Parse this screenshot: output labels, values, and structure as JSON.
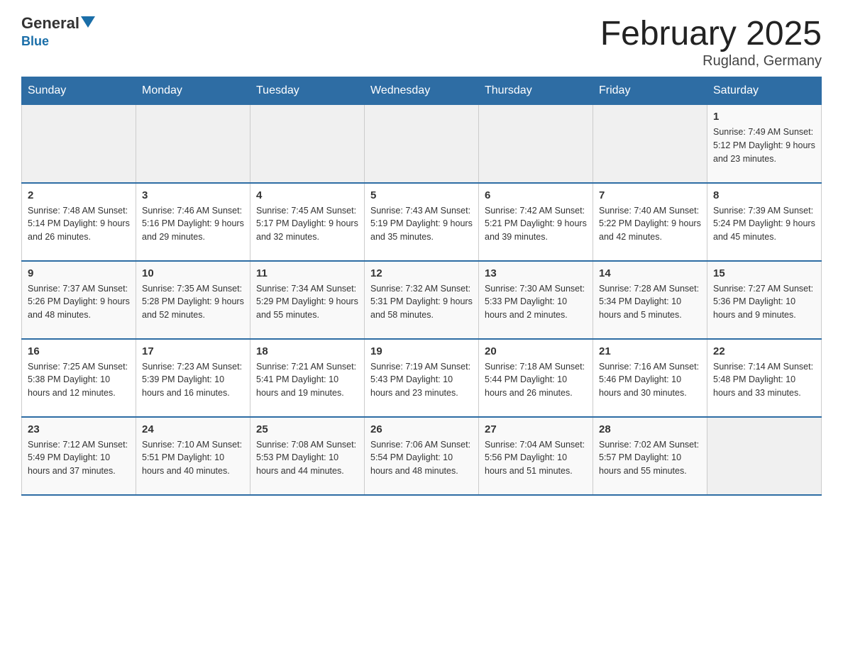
{
  "header": {
    "logo_general": "General",
    "logo_blue": "Blue",
    "month_title": "February 2025",
    "location": "Rugland, Germany"
  },
  "weekdays": [
    "Sunday",
    "Monday",
    "Tuesday",
    "Wednesday",
    "Thursday",
    "Friday",
    "Saturday"
  ],
  "weeks": [
    [
      {
        "day": "",
        "info": ""
      },
      {
        "day": "",
        "info": ""
      },
      {
        "day": "",
        "info": ""
      },
      {
        "day": "",
        "info": ""
      },
      {
        "day": "",
        "info": ""
      },
      {
        "day": "",
        "info": ""
      },
      {
        "day": "1",
        "info": "Sunrise: 7:49 AM\nSunset: 5:12 PM\nDaylight: 9 hours and 23 minutes."
      }
    ],
    [
      {
        "day": "2",
        "info": "Sunrise: 7:48 AM\nSunset: 5:14 PM\nDaylight: 9 hours and 26 minutes."
      },
      {
        "day": "3",
        "info": "Sunrise: 7:46 AM\nSunset: 5:16 PM\nDaylight: 9 hours and 29 minutes."
      },
      {
        "day": "4",
        "info": "Sunrise: 7:45 AM\nSunset: 5:17 PM\nDaylight: 9 hours and 32 minutes."
      },
      {
        "day": "5",
        "info": "Sunrise: 7:43 AM\nSunset: 5:19 PM\nDaylight: 9 hours and 35 minutes."
      },
      {
        "day": "6",
        "info": "Sunrise: 7:42 AM\nSunset: 5:21 PM\nDaylight: 9 hours and 39 minutes."
      },
      {
        "day": "7",
        "info": "Sunrise: 7:40 AM\nSunset: 5:22 PM\nDaylight: 9 hours and 42 minutes."
      },
      {
        "day": "8",
        "info": "Sunrise: 7:39 AM\nSunset: 5:24 PM\nDaylight: 9 hours and 45 minutes."
      }
    ],
    [
      {
        "day": "9",
        "info": "Sunrise: 7:37 AM\nSunset: 5:26 PM\nDaylight: 9 hours and 48 minutes."
      },
      {
        "day": "10",
        "info": "Sunrise: 7:35 AM\nSunset: 5:28 PM\nDaylight: 9 hours and 52 minutes."
      },
      {
        "day": "11",
        "info": "Sunrise: 7:34 AM\nSunset: 5:29 PM\nDaylight: 9 hours and 55 minutes."
      },
      {
        "day": "12",
        "info": "Sunrise: 7:32 AM\nSunset: 5:31 PM\nDaylight: 9 hours and 58 minutes."
      },
      {
        "day": "13",
        "info": "Sunrise: 7:30 AM\nSunset: 5:33 PM\nDaylight: 10 hours and 2 minutes."
      },
      {
        "day": "14",
        "info": "Sunrise: 7:28 AM\nSunset: 5:34 PM\nDaylight: 10 hours and 5 minutes."
      },
      {
        "day": "15",
        "info": "Sunrise: 7:27 AM\nSunset: 5:36 PM\nDaylight: 10 hours and 9 minutes."
      }
    ],
    [
      {
        "day": "16",
        "info": "Sunrise: 7:25 AM\nSunset: 5:38 PM\nDaylight: 10 hours and 12 minutes."
      },
      {
        "day": "17",
        "info": "Sunrise: 7:23 AM\nSunset: 5:39 PM\nDaylight: 10 hours and 16 minutes."
      },
      {
        "day": "18",
        "info": "Sunrise: 7:21 AM\nSunset: 5:41 PM\nDaylight: 10 hours and 19 minutes."
      },
      {
        "day": "19",
        "info": "Sunrise: 7:19 AM\nSunset: 5:43 PM\nDaylight: 10 hours and 23 minutes."
      },
      {
        "day": "20",
        "info": "Sunrise: 7:18 AM\nSunset: 5:44 PM\nDaylight: 10 hours and 26 minutes."
      },
      {
        "day": "21",
        "info": "Sunrise: 7:16 AM\nSunset: 5:46 PM\nDaylight: 10 hours and 30 minutes."
      },
      {
        "day": "22",
        "info": "Sunrise: 7:14 AM\nSunset: 5:48 PM\nDaylight: 10 hours and 33 minutes."
      }
    ],
    [
      {
        "day": "23",
        "info": "Sunrise: 7:12 AM\nSunset: 5:49 PM\nDaylight: 10 hours and 37 minutes."
      },
      {
        "day": "24",
        "info": "Sunrise: 7:10 AM\nSunset: 5:51 PM\nDaylight: 10 hours and 40 minutes."
      },
      {
        "day": "25",
        "info": "Sunrise: 7:08 AM\nSunset: 5:53 PM\nDaylight: 10 hours and 44 minutes."
      },
      {
        "day": "26",
        "info": "Sunrise: 7:06 AM\nSunset: 5:54 PM\nDaylight: 10 hours and 48 minutes."
      },
      {
        "day": "27",
        "info": "Sunrise: 7:04 AM\nSunset: 5:56 PM\nDaylight: 10 hours and 51 minutes."
      },
      {
        "day": "28",
        "info": "Sunrise: 7:02 AM\nSunset: 5:57 PM\nDaylight: 10 hours and 55 minutes."
      },
      {
        "day": "",
        "info": ""
      }
    ]
  ]
}
